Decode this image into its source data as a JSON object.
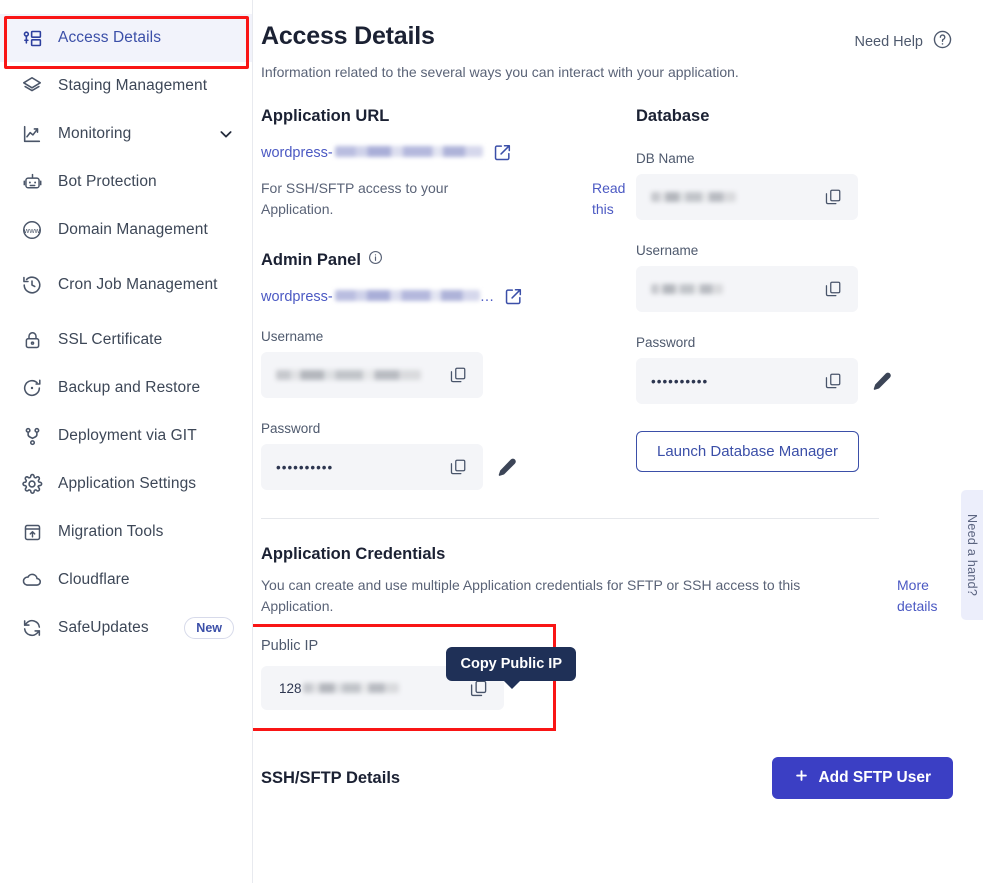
{
  "sidebar": {
    "items": [
      {
        "label": "Access Details",
        "icon": "access-details-icon",
        "active": true
      },
      {
        "label": "Staging Management",
        "icon": "layers-icon",
        "active": false
      },
      {
        "label": "Monitoring",
        "icon": "chart-line-icon",
        "active": false,
        "chevron": "chevron-down-icon"
      },
      {
        "label": "Bot Protection",
        "icon": "robot-icon",
        "active": false
      },
      {
        "label": "Domain Management",
        "icon": "www-globe-icon",
        "active": false
      },
      {
        "label": "Cron Job Management",
        "icon": "clock-history-icon",
        "active": false
      },
      {
        "label": "SSL Certificate",
        "icon": "lock-icon",
        "active": false
      },
      {
        "label": "Backup and Restore",
        "icon": "restore-icon",
        "active": false
      },
      {
        "label": "Deployment via GIT",
        "icon": "git-branch-icon",
        "active": false
      },
      {
        "label": "Application Settings",
        "icon": "gear-icon",
        "active": false
      },
      {
        "label": "Migration Tools",
        "icon": "migration-upload-icon",
        "active": false
      },
      {
        "label": "Cloudflare",
        "icon": "cloud-icon",
        "active": false
      },
      {
        "label": "SafeUpdates",
        "icon": "refresh-sync-icon",
        "active": false,
        "badge": "New"
      }
    ]
  },
  "header": {
    "title": "Access Details",
    "subtitle": "Information related to the several ways you can interact with your application.",
    "need_help": "Need Help",
    "need_help_icon": "question-circle-icon"
  },
  "application_url": {
    "section_title": "Application URL",
    "url_prefix": "wordpress-",
    "open_icon": "external-link-icon",
    "help_text": "For SSH/SFTP access to your Application.",
    "read_this": "Read this"
  },
  "admin_panel": {
    "section_title": "Admin Panel",
    "info_icon": "info-circle-icon",
    "url_prefix": "wordpress-",
    "open_icon": "external-link-icon",
    "username_label": "Username",
    "username_value": "",
    "password_label": "Password",
    "password_value": "••••••••••",
    "copy_icon": "copy-icon",
    "edit_icon": "pencil-icon"
  },
  "database": {
    "section_title": "Database",
    "db_name_label": "DB Name",
    "db_name_value": "",
    "username_label": "Username",
    "username_value": "",
    "password_label": "Password",
    "password_value": "••••••••••",
    "copy_icon": "copy-icon",
    "edit_icon": "pencil-icon",
    "launch_button": "Launch Database Manager"
  },
  "application_credentials": {
    "section_title": "Application Credentials",
    "description": "You can create and use multiple Application credentials for SFTP or SSH access to this Application.",
    "more_details": "More details",
    "public_ip_label": "Public IP",
    "public_ip_value": "128",
    "copy_tooltip": "Copy Public IP",
    "copy_icon": "copy-icon"
  },
  "ssh_sftp": {
    "section_title": "SSH/SFTP Details",
    "add_user_button": "Add SFTP User",
    "add_icon": "plus-icon"
  },
  "need_a_hand": {
    "label": "Need a hand?"
  },
  "colors": {
    "accent": "#3b3fc4",
    "link": "#4b59c3",
    "highlight": "#f91515",
    "tooltip_bg": "#1f3057",
    "field_bg": "#f4f5f8",
    "active_nav_bg": "#f2f3fb"
  }
}
